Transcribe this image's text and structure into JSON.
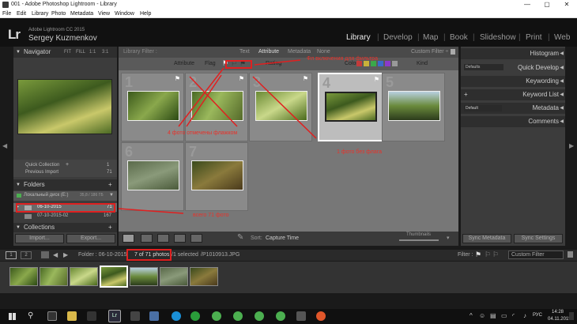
{
  "window": {
    "title": "001 - Adobe Photoshop Lightroom - Library",
    "minimize": "—",
    "maximize": "▢",
    "close": "✕"
  },
  "menu": [
    "File",
    "Edit",
    "Library",
    "Photo",
    "Metadata",
    "View",
    "Window",
    "Help"
  ],
  "identity": {
    "logo": "Lr",
    "product": "Adobe Lightroom CC 2015",
    "user": "Sergey Kuzmenkov"
  },
  "modules": [
    "Library",
    "Develop",
    "Map",
    "Book",
    "Slideshow",
    "Print",
    "Web"
  ],
  "left": {
    "navigator": {
      "title": "Navigator",
      "zoom": [
        "FIT",
        "FILL",
        "1:1",
        "3:1"
      ]
    },
    "catalog": [
      {
        "label": "Quick Collection",
        "count": "1"
      },
      {
        "label": "Previous Import",
        "count": "71"
      }
    ],
    "folders": {
      "title": "Folders",
      "add": "+",
      "volume": "Локальный диск (E:)",
      "volume_size": "35,8 / 186 ГБ",
      "items": [
        {
          "label": "06-10-2015",
          "count": "71"
        },
        {
          "label": "07-10-2015-02",
          "count": "167"
        }
      ]
    },
    "collections": {
      "title": "Collections",
      "add": "+"
    },
    "import": "Import...",
    "export": "Export..."
  },
  "filter": {
    "title": "Library Filter :",
    "tabs": [
      "Text",
      "Attribute",
      "Metadata",
      "None"
    ],
    "preset": "Custom Filter ÷",
    "attr_label": "Attribute",
    "flag_label": "Flag",
    "rating_label": "Rating",
    "color_label": "Color",
    "kind_label": "Kind",
    "color_swatches": [
      "#c23b3b",
      "#c9b23a",
      "#3aa84a",
      "#3a6ac9",
      "#8a3ac9",
      "#999999"
    ]
  },
  "grid": {
    "cells": [
      {
        "num": "1",
        "img": "linear-gradient(135deg,#3c5a1c,#8aa84c 50%,#2c4a14)"
      },
      {
        "num": "2",
        "img": "linear-gradient(120deg,#4a6a24,#9ab85c 45%,#556a2a)"
      },
      {
        "num": "3",
        "img": "linear-gradient(150deg,#6a8a34,#c9d88a 50%,#4a6a1c)"
      },
      {
        "num": "4",
        "img": "linear-gradient(160deg,#7a9a3c,#3d5a1e 40%,#c9c86a 70%,#4c6a24)"
      },
      {
        "num": "5",
        "img": "linear-gradient(180deg,#b8d0e0,#6a8a3c 50%,#2c3c1c)"
      },
      {
        "num": "6",
        "img": "linear-gradient(160deg,#5a6a4a,#8a9a7a 50%,#4a5a3a)"
      },
      {
        "num": "7",
        "img": "linear-gradient(150deg,#3a4a1c,#8a7a3c 50%,#4a3a1c)"
      }
    ]
  },
  "toolbar": {
    "sort_label": "Sort:",
    "sort_value": "Capture Time",
    "thumb_label": "Thumbnails"
  },
  "right": {
    "histogram": "Histogram",
    "quick_develop": "Quick Develop",
    "saved_preset": "Defaults",
    "keywording": "Keywording",
    "keyword_list": "Keyword List",
    "metadata": "Metadata",
    "metadata_preset": "Default",
    "comments": "Comments",
    "sync_metadata": "Sync Metadata",
    "sync_settings": "Sync Settings"
  },
  "filmstrip": {
    "pages": [
      "1",
      "2"
    ],
    "folder": "Folder : 06-10-2015",
    "count": "7 of 71 photos",
    "selected": "/1 selected",
    "filename": "/P1010913.JPG",
    "filter_label": "Filter :",
    "filter_value": "Custom Filter",
    "thumbs": [
      "linear-gradient(135deg,#3c5a1c,#8aa84c 50%,#2c4a14)",
      "linear-gradient(120deg,#4a6a24,#9ab85c 45%,#556a2a)",
      "linear-gradient(150deg,#6a8a34,#c9d88a 50%,#4a6a1c)",
      "linear-gradient(160deg,#7a9a3c,#3d5a1e 40%,#c9c86a 70%,#4c6a24)",
      "linear-gradient(180deg,#b8d0e0,#6a8a3c 50%,#2c3c1c)",
      "linear-gradient(160deg,#5a6a4a,#8a9a7a 50%,#4a5a3a)",
      "linear-gradient(150deg,#3a4a1c,#8a7a3c 50%,#4a3a1c)"
    ]
  },
  "annotations": {
    "flags_enabled": "Фл включения для фильтра",
    "flagged_photos": "4 фото отмечены флажком",
    "unflagged": "1 фото без флага",
    "all_photos": "всего 71 фото"
  },
  "taskbar": {
    "lang": "РУС",
    "time": "14:28",
    "date": "04.11.2015"
  }
}
